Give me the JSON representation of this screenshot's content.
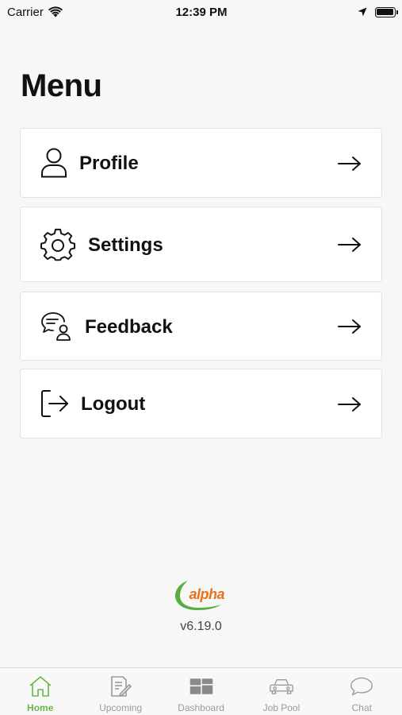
{
  "status_bar": {
    "carrier": "Carrier",
    "time": "12:39 PM"
  },
  "page": {
    "title": "Menu"
  },
  "menu": {
    "items": [
      {
        "label": "Profile",
        "icon": "person-icon"
      },
      {
        "label": "Settings",
        "icon": "gear-icon"
      },
      {
        "label": "Feedback",
        "icon": "feedback-chat-icon"
      },
      {
        "label": "Logout",
        "icon": "logout-icon"
      }
    ]
  },
  "footer": {
    "logo_text": "alpha",
    "version": "v6.19.0"
  },
  "tab_bar": {
    "tabs": [
      {
        "label": "Home",
        "icon": "home-icon",
        "active": true
      },
      {
        "label": "Upcoming",
        "icon": "document-edit-icon",
        "active": false
      },
      {
        "label": "Dashboard",
        "icon": "dashboard-icon",
        "active": false
      },
      {
        "label": "Job Pool",
        "icon": "car-icon",
        "active": false
      },
      {
        "label": "Chat",
        "icon": "chat-bubble-icon",
        "active": false
      }
    ]
  },
  "colors": {
    "accent_green": "#6bb54a",
    "logo_orange": "#e8711d",
    "logo_green": "#5aae3f",
    "background": "#f7f7f7"
  }
}
